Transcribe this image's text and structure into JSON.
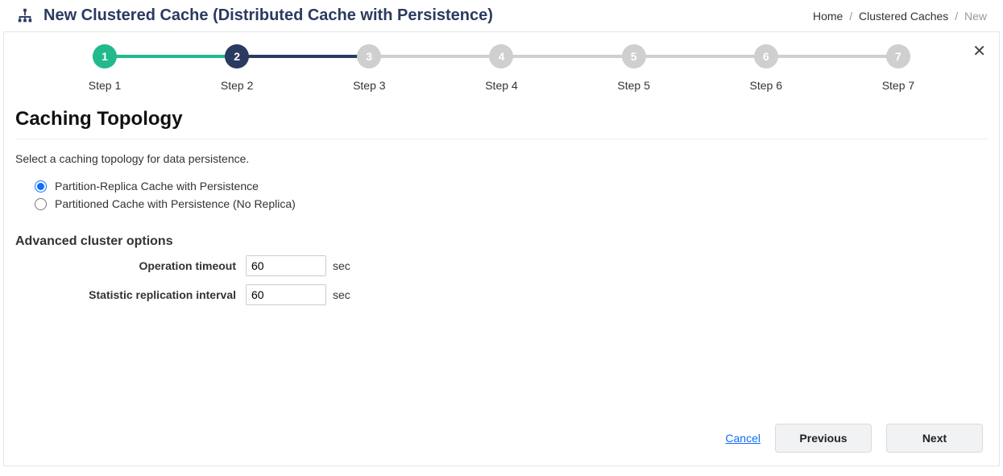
{
  "header": {
    "title": "New Clustered Cache (Distributed Cache with Persistence)"
  },
  "breadcrumb": {
    "items": [
      "Home",
      "Clustered Caches",
      "New"
    ],
    "separator": "/"
  },
  "stepper": {
    "steps": [
      {
        "num": "1",
        "label": "Step 1",
        "state": "done"
      },
      {
        "num": "2",
        "label": "Step 2",
        "state": "active"
      },
      {
        "num": "3",
        "label": "Step 3",
        "state": "pending"
      },
      {
        "num": "4",
        "label": "Step 4",
        "state": "pending"
      },
      {
        "num": "5",
        "label": "Step 5",
        "state": "pending"
      },
      {
        "num": "6",
        "label": "Step 6",
        "state": "pending"
      },
      {
        "num": "7",
        "label": "Step 7",
        "state": "pending"
      }
    ],
    "segments": [
      {
        "color": "#20ba8d"
      },
      {
        "color": "#2b3a60"
      },
      {
        "color": "#cfcfcf"
      },
      {
        "color": "#cfcfcf"
      },
      {
        "color": "#cfcfcf"
      },
      {
        "color": "#cfcfcf"
      }
    ]
  },
  "section": {
    "title": "Caching Topology",
    "instruction": "Select a caching topology for data persistence."
  },
  "topology_options": [
    {
      "label": "Partition-Replica Cache with Persistence",
      "checked": true
    },
    {
      "label": "Partitioned Cache with Persistence (No Replica)",
      "checked": false
    }
  ],
  "advanced": {
    "title": "Advanced cluster options",
    "fields": [
      {
        "label": "Operation timeout",
        "value": "60",
        "unit": "sec"
      },
      {
        "label": "Statistic replication interval",
        "value": "60",
        "unit": "sec"
      }
    ]
  },
  "footer": {
    "cancel": "Cancel",
    "previous": "Previous",
    "next": "Next"
  },
  "icons": {
    "close": "✕"
  }
}
